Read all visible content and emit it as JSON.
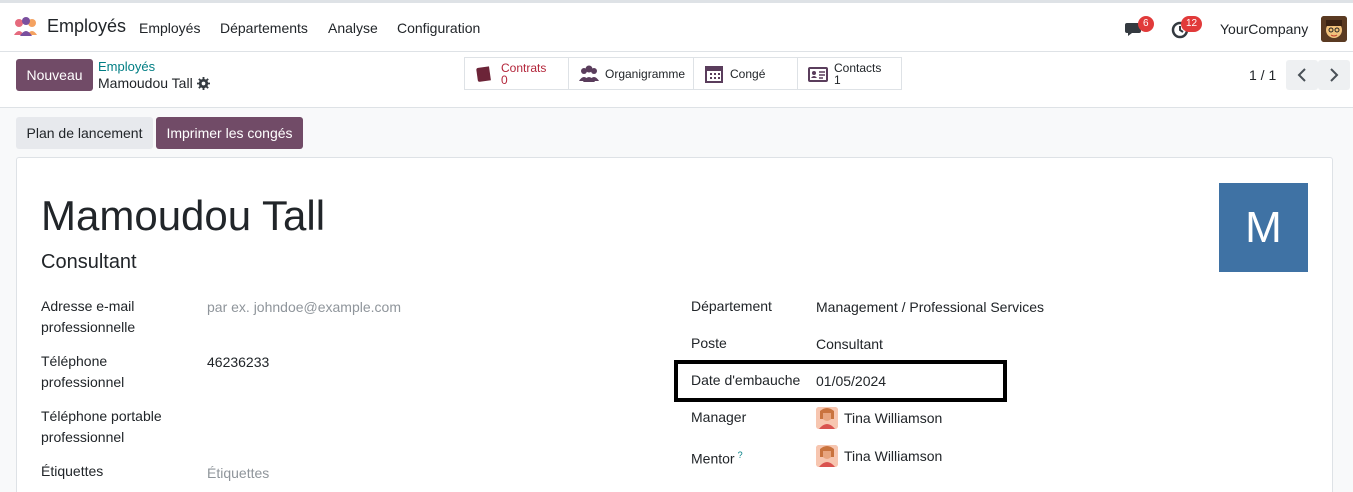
{
  "navbar": {
    "app_title": "Employés",
    "menu": [
      "Employés",
      "Départements",
      "Analyse",
      "Configuration"
    ],
    "chat_count": "6",
    "activity_count": "12",
    "company": "YourCompany"
  },
  "control": {
    "new_button": "Nouveau",
    "breadcrumb_parent": "Employés",
    "breadcrumb_current": "Mamoudou Tall",
    "smart_buttons": [
      {
        "label": "Contrats",
        "value": "0",
        "icon": "book-icon"
      },
      {
        "label": "Organigramme",
        "value": "",
        "icon": "people-icon"
      },
      {
        "label": "Congé",
        "value": "",
        "icon": "calendar-icon"
      },
      {
        "label": "Contacts",
        "value": "1",
        "icon": "id-card-icon"
      }
    ],
    "pager": "1 / 1"
  },
  "actions": {
    "plan": "Plan de lancement",
    "print": "Imprimer les congés"
  },
  "employee": {
    "name": "Mamoudou Tall",
    "job_title": "Consultant",
    "avatar_letter": "M",
    "avatar_color": "#3f72a4"
  },
  "left_fields": [
    {
      "label": "Adresse e-mail professionnelle",
      "value": "",
      "placeholder": "par ex. johndoe@example.com"
    },
    {
      "label": "Téléphone professionnel",
      "value": "46236233",
      "placeholder": ""
    },
    {
      "label": "Téléphone portable professionnel",
      "value": "",
      "placeholder": ""
    },
    {
      "label": "Étiquettes",
      "value": "",
      "placeholder": "Étiquettes"
    }
  ],
  "right_fields": [
    {
      "label": "Département",
      "value": "Management / Professional Services"
    },
    {
      "label": "Poste",
      "value": "Consultant"
    },
    {
      "label": "Date d'embauche",
      "value": "01/05/2024"
    },
    {
      "label": "Manager",
      "value": "Tina Williamson"
    },
    {
      "label": "Mentor",
      "value": "Tina Williamson",
      "help": "?"
    }
  ],
  "colors": {
    "primary": "#714b67",
    "link": "#017e84",
    "badge": "#e13a3a"
  }
}
